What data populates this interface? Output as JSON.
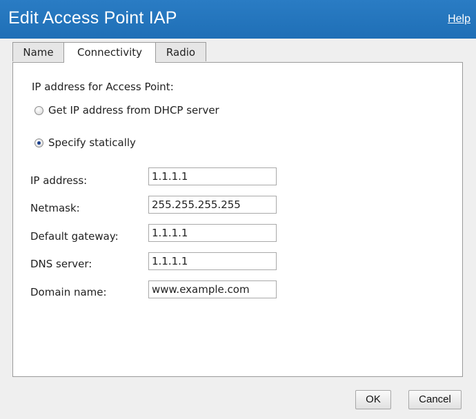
{
  "window": {
    "title": "Edit Access Point IAP",
    "help_label": "Help"
  },
  "tabs": [
    {
      "label": "Name",
      "active": false
    },
    {
      "label": "Connectivity",
      "active": true
    },
    {
      "label": "Radio",
      "active": false
    }
  ],
  "connectivity": {
    "section_label": "IP address for Access Point:",
    "radio_dhcp": {
      "label": "Get IP address from DHCP server",
      "checked": false
    },
    "radio_static": {
      "label": "Specify statically",
      "checked": true
    },
    "fields": {
      "ip_address": {
        "label": "IP address:",
        "value": "1.1.1.1"
      },
      "netmask": {
        "label": "Netmask:",
        "value": "255.255.255.255"
      },
      "default_gateway": {
        "label": "Default gateway:",
        "value": "1.1.1.1"
      },
      "dns_server": {
        "label": "DNS server:",
        "value": "1.1.1.1"
      },
      "domain_name": {
        "label": "Domain name:",
        "value": "www.example.com"
      }
    }
  },
  "buttons": {
    "ok": "OK",
    "cancel": "Cancel"
  },
  "colors": {
    "titlebar": "#1f6fb6",
    "panel": "#ffffff",
    "background": "#efefef"
  }
}
